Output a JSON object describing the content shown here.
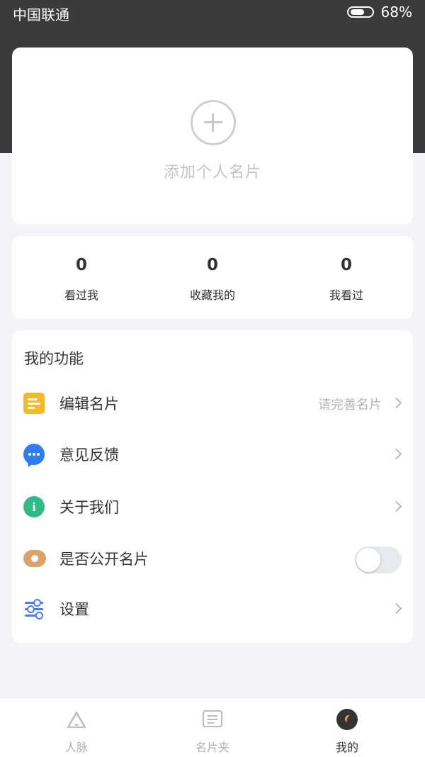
{
  "status_bar": {
    "carrier": "中国联通",
    "battery_percent": "68%",
    "battery_level": 0.68
  },
  "profile_card": {
    "add_label": "添加个人名片",
    "icon": "plus-circle-icon"
  },
  "stats": [
    {
      "value": "0",
      "label": "看过我"
    },
    {
      "value": "0",
      "label": "收藏我的"
    },
    {
      "value": "0",
      "label": "我看过"
    }
  ],
  "functions": {
    "title": "我的功能",
    "items": [
      {
        "label": "编辑名片",
        "hint": "请完善名片",
        "icon": "edit-card-icon",
        "color": "#f7b928"
      },
      {
        "label": "意见反馈",
        "icon": "chat-bubble-icon",
        "color": "#2f7cf6"
      },
      {
        "label": "关于我们",
        "icon": "info-icon",
        "color": "#2fbc84",
        "glyph": "i"
      },
      {
        "label": "是否公开名片",
        "icon": "eye-icon",
        "color": "#d9a36a",
        "toggle_on": false
      },
      {
        "label": "设置",
        "icon": "sliders-icon",
        "color": "#4a7cf2"
      }
    ]
  },
  "tabbar": {
    "tabs": [
      {
        "label": "人脉",
        "icon": "contacts-icon",
        "active": false
      },
      {
        "label": "名片夹",
        "icon": "card-holder-icon",
        "active": false
      },
      {
        "label": "我的",
        "icon": "profile-icon",
        "active": true
      }
    ]
  }
}
